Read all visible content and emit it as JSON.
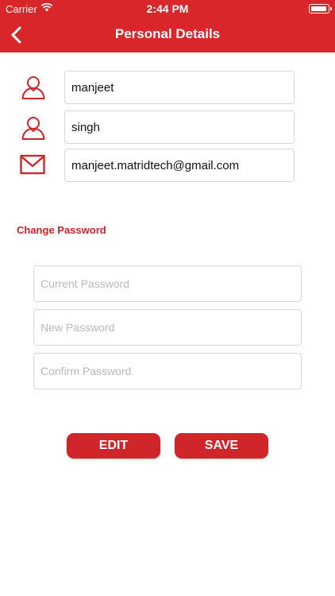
{
  "status": {
    "carrier": "Carrier",
    "time": "2:44 PM"
  },
  "header": {
    "title": "Personal Details",
    "back_icon": "chevron-left-icon"
  },
  "profile": {
    "first_name": {
      "icon": "user-icon",
      "value": "manjeet"
    },
    "last_name": {
      "icon": "user-icon",
      "value": "singh"
    },
    "email": {
      "icon": "envelope-icon",
      "value": "manjeet.matridtech@gmail.com"
    }
  },
  "password": {
    "link_label": "Change Password",
    "current_placeholder": "Current Password",
    "new_placeholder": "New Password",
    "confirm_placeholder": "Confirm Password"
  },
  "actions": {
    "edit_label": "EDIT",
    "save_label": "SAVE"
  },
  "colors": {
    "brand_red": "#d8262a",
    "link_red": "#c8262b",
    "border": "#d8d8d8",
    "placeholder": "#b9b9b9"
  }
}
